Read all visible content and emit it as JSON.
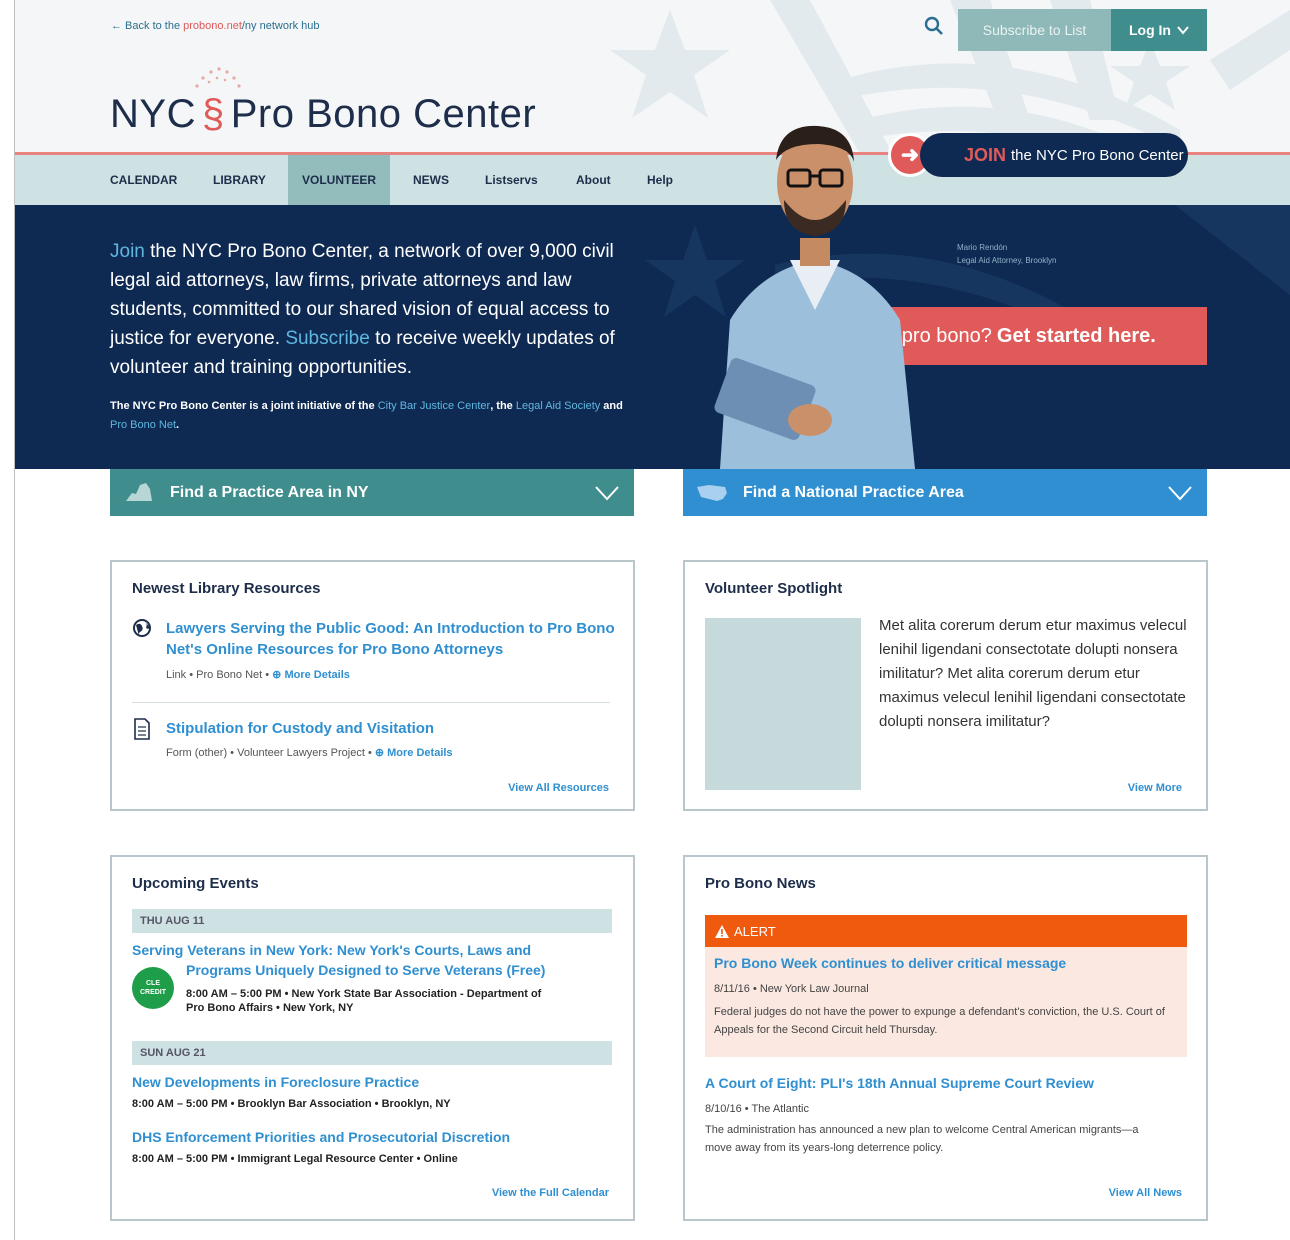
{
  "header": {
    "back_prefix": "← Back to the ",
    "back_accent": "probono.net",
    "back_suffix": "/ny network hub",
    "logo_left": "NYC",
    "logo_section": "§",
    "logo_right": "Pro Bono Center",
    "subscribe_label": "Subscribe to List",
    "login_label": "Log In",
    "join_word": "JOIN",
    "join_rest": "the NYC Pro Bono Center"
  },
  "nav": {
    "items": [
      {
        "label": "CALENDAR"
      },
      {
        "label": "LIBRARY"
      },
      {
        "label": "VOLUNTEER"
      },
      {
        "label": "NEWS"
      },
      {
        "label": "Listservs"
      },
      {
        "label": "About"
      },
      {
        "label": "Help"
      }
    ],
    "active": "VOLUNTEER"
  },
  "hero": {
    "join_link": "Join",
    "text_1": " the NYC Pro Bono Center, a network of over 9,000 civil legal aid attorneys, law firms, private attorneys and law students, committed to our shared vision of equal access to justice for everyone. ",
    "subscribe_link": "Subscribe",
    "text_2": " to receive weekly updates of volunteer and training opportunities.",
    "sub_1": "The NYC Pro Bono Center is a joint initiative of the ",
    "sub_link_1": "City Bar Justice Center",
    "sub_2": ", the ",
    "sub_link_2": "Legal Aid Society",
    "sub_3": " and ",
    "sub_link_3": "Pro Bono Net",
    "sub_4": ".",
    "caption_name": "Mario Rendón",
    "caption_role": "Legal Aid Attorney, Brooklyn",
    "cta_lead": "New to pro bono?",
    "cta_bold": "Get started here."
  },
  "practice": {
    "ny_label": "Find a Practice Area in NY",
    "national_label": "Find a National Practice Area"
  },
  "library": {
    "title": "Newest Library Resources",
    "items": [
      {
        "title": "Lawyers Serving the Public Good: An Introduction to Pro Bono Net's Online Resources for Pro Bono Attorneys",
        "type": "Link",
        "source": "Pro Bono Net",
        "details": "More Details",
        "icon": "globe-icon"
      },
      {
        "title": "Stipulation for Custody and Visitation",
        "type": "Form (other)",
        "source": "Volunteer Lawyers Project",
        "details": "More Details",
        "icon": "document-icon"
      }
    ],
    "view_all": "View All Resources"
  },
  "spotlight": {
    "title": "Volunteer Spotlight",
    "text": "Met alita corerum derum etur maximus velecul lenihil ligendani consectotate dolupti nonsera imilitatur? Met alita corerum derum etur maximus velecul lenihil ligendani consectotate dolupti nonsera imilitatur?",
    "view_more": "View More"
  },
  "events": {
    "title": "Upcoming Events",
    "groups": [
      {
        "date": "THU AUG 11"
      },
      {
        "date": "SUN AUG 21"
      }
    ],
    "items": [
      {
        "title_1": "Serving Veterans in New York: New York's Courts, Laws and",
        "title_2": "Programs Uniquely Designed to Serve Veterans (Free)",
        "meta_1": "8:00 AM – 5:00 PM • New York State Bar Association - Department of",
        "meta_2": "Pro Bono Affairs • New York, NY"
      },
      {
        "title": "New Developments in Foreclosure Practice",
        "meta": "8:00 AM – 5:00 PM • Brooklyn Bar Association • Brooklyn, NY"
      },
      {
        "title": "DHS Enforcement Priorities and Prosecutorial Discretion",
        "meta": "8:00 AM – 5:00 PM • Immigrant Legal Resource Center • Online"
      }
    ],
    "cle_line1": "CLE",
    "cle_line2": "CREDIT",
    "view_all": "View the Full Calendar"
  },
  "news": {
    "title": "Pro Bono News",
    "alert_label": "ALERT",
    "items": [
      {
        "title": "Pro Bono Week continues to deliver critical message",
        "meta": "8/11/16 • New York Law Journal",
        "desc": "Federal judges do not have the power to expunge a defendant's conviction, the U.S. Court of Appeals for the Second Circuit held Thursday."
      },
      {
        "title": "A Court of Eight: PLI's 18th Annual Supreme Court Review",
        "meta": "8/10/16 • The Atlantic",
        "desc": "The administration has announced a new plan to welcome Central American migrants—a move away from its years-long deterrence policy."
      }
    ],
    "view_all": "View All News"
  },
  "colors": {
    "navy": "#0f2a52",
    "teal": "#3f8d8d",
    "coral": "#e05a5a",
    "blue": "#2f8fd0",
    "alert_orange": "#ef5a0e"
  }
}
